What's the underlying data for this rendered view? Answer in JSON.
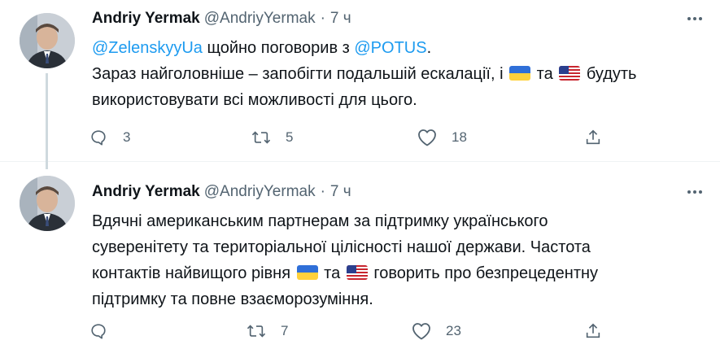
{
  "tweets": [
    {
      "author_name": "Andriy Yermak",
      "handle": "@AndriyYermak",
      "separator": "·",
      "time": "7 ч",
      "lines": [
        {
          "parts": [
            {
              "type": "mention",
              "text": "@ZelenskyyUa"
            },
            {
              "type": "text",
              "text": " щойно поговорив з "
            },
            {
              "type": "mention",
              "text": "@POTUS"
            },
            {
              "type": "text",
              "text": "."
            }
          ]
        },
        {
          "parts": [
            {
              "type": "text",
              "text": "Зараз найголовніше – запобігти подальшій ескалації, і "
            },
            {
              "type": "flag",
              "flag": "ukraine-flag"
            },
            {
              "type": "text",
              "text": " та "
            },
            {
              "type": "flag",
              "flag": "usa-flag"
            },
            {
              "type": "text",
              "text": " будуть"
            }
          ]
        },
        {
          "parts": [
            {
              "type": "text",
              "text": "використовувати всі можливості для цього."
            }
          ]
        }
      ],
      "reply_count": "3",
      "retweet_count": "5",
      "like_count": "18"
    },
    {
      "author_name": "Andriy Yermak",
      "handle": "@AndriyYermak",
      "separator": "·",
      "time": "7 ч",
      "lines": [
        {
          "parts": [
            {
              "type": "text",
              "text": "Вдячні американським партнерам за підтримку українського"
            }
          ]
        },
        {
          "parts": [
            {
              "type": "text",
              "text": "суверенітету та територіальної цілісності нашої держави. Частота"
            }
          ]
        },
        {
          "parts": [
            {
              "type": "text",
              "text": "контактів найвищого рівня "
            },
            {
              "type": "flag",
              "flag": "ukraine-flag"
            },
            {
              "type": "text",
              "text": " та "
            },
            {
              "type": "flag",
              "flag": "usa-flag"
            },
            {
              "type": "text",
              "text": " говорить про безпрецедентну"
            }
          ]
        },
        {
          "parts": [
            {
              "type": "text",
              "text": "підтримку та повне взаєморозуміння."
            }
          ]
        }
      ],
      "reply_count": "",
      "retweet_count": "7",
      "like_count": "23"
    }
  ],
  "icons": {
    "more": "more-horizontal-icon",
    "reply": "reply-icon",
    "retweet": "retweet-icon",
    "like": "like-icon",
    "share": "share-icon"
  },
  "colors": {
    "link": "#1d9bf0",
    "secondary_text": "#536471",
    "primary_text": "#0f1419"
  }
}
